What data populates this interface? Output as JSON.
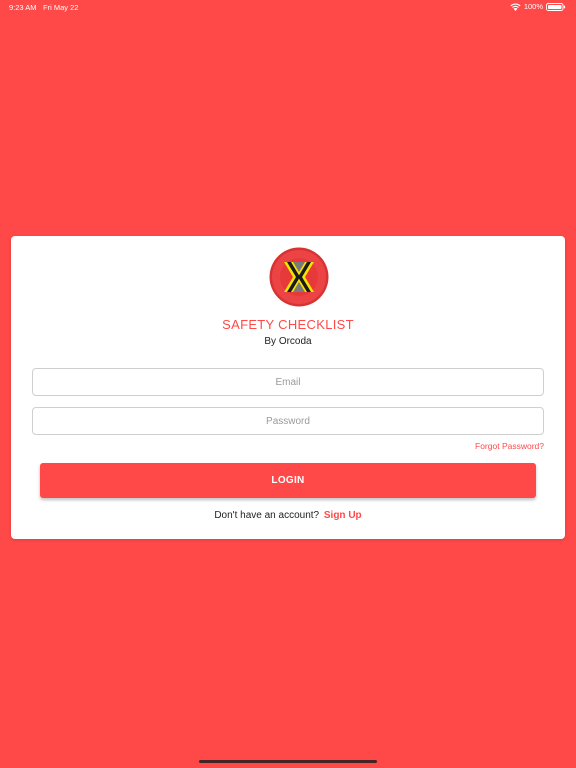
{
  "status_bar": {
    "time": "9:23 AM",
    "date": "Fri May 22",
    "battery": "100%",
    "icons": [
      "wifi-icon",
      "battery-icon"
    ]
  },
  "colors": {
    "background": "#FF4948",
    "accent": "#FF4948",
    "card": "#FFFFFF",
    "logo_yellow": "#F5E400",
    "logo_red": "#E8393A",
    "logo_dark": "#222222"
  },
  "login_card": {
    "logo_icon": "safety-checklist-logo",
    "title": "SAFETY CHECKLIST",
    "subtitle": "By Orcoda",
    "email": {
      "placeholder": "Email",
      "value": ""
    },
    "password": {
      "placeholder": "Password",
      "value": ""
    },
    "forgot_password": "Forgot Password?",
    "login_label": "LOGIN",
    "signup_prompt": "Don't have an account?",
    "signup_link": "Sign Up"
  }
}
